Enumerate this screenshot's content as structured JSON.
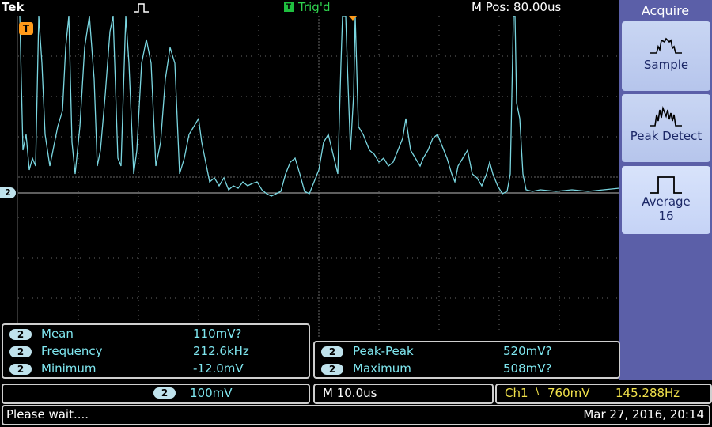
{
  "header": {
    "brand": "Tek",
    "trigger_status": "Trig'd",
    "trigger_led": "T",
    "horizontal_position": "M Pos: 80.00us"
  },
  "screen": {
    "channel_marker": "2",
    "trigger_marker": "T",
    "trace_color": "#7ad6e0"
  },
  "side_menu": {
    "title": "Acquire",
    "buttons": [
      {
        "label": "Sample",
        "sub": ""
      },
      {
        "label": "Peak Detect",
        "sub": ""
      },
      {
        "label": "Average",
        "sub": "16"
      }
    ]
  },
  "measurements_left": [
    {
      "ch": "2",
      "label": "Mean",
      "value": "110mV?"
    },
    {
      "ch": "2",
      "label": "Frequency",
      "value": "212.6kHz"
    },
    {
      "ch": "2",
      "label": "Minimum",
      "value": "-12.0mV"
    }
  ],
  "measurements_right": [
    {
      "ch": "2",
      "label": "Peak-Peak",
      "value": "520mV?"
    },
    {
      "ch": "2",
      "label": "Maximum",
      "value": "508mV?"
    }
  ],
  "channel_scale": {
    "ch": "2",
    "value": "100mV"
  },
  "timebase": "M 10.0us",
  "trigger_readout": {
    "ch": "Ch1",
    "slope": "\\",
    "level": "760mV",
    "freq": "145.288Hz"
  },
  "status": {
    "message": "Please wait....",
    "datetime": "Mar 27, 2016, 20:14"
  }
}
